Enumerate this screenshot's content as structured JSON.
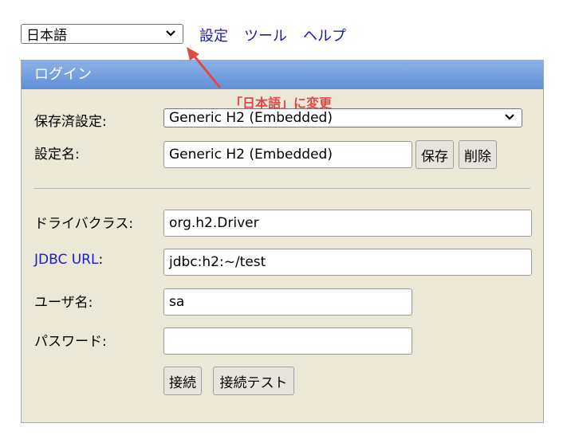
{
  "language_select": {
    "value": "日本語"
  },
  "top_nav": {
    "settings": "設定",
    "tools": "ツール",
    "help": "ヘルプ"
  },
  "login_panel": {
    "title": "ログイン",
    "annotation": "「日本語」に変更",
    "saved_settings_label": "保存済設定:",
    "saved_settings_value": "Generic H2 (Embedded)",
    "setting_name_label": "設定名:",
    "setting_name_value": "Generic H2 (Embedded)",
    "save_button": "保存",
    "delete_button": "削除",
    "driver_class_label": "ドライバクラス:",
    "driver_class_value": "org.h2.Driver",
    "jdbc_url_link": "JDBC URL",
    "jdbc_url_colon": ":",
    "jdbc_url_value": "jdbc:h2:~/test",
    "username_label": "ユーザ名:",
    "username_value": "sa",
    "password_label": "パスワード:",
    "password_value": "",
    "connect_button": "接続",
    "test_connect_button": "接続テスト"
  },
  "colors": {
    "header_gradient_top": "#8db2e6",
    "header_gradient_bottom": "#5f8fd8",
    "panel_bg": "#ebe8d8",
    "link": "#1a1aa6",
    "annotation": "#e04848"
  }
}
